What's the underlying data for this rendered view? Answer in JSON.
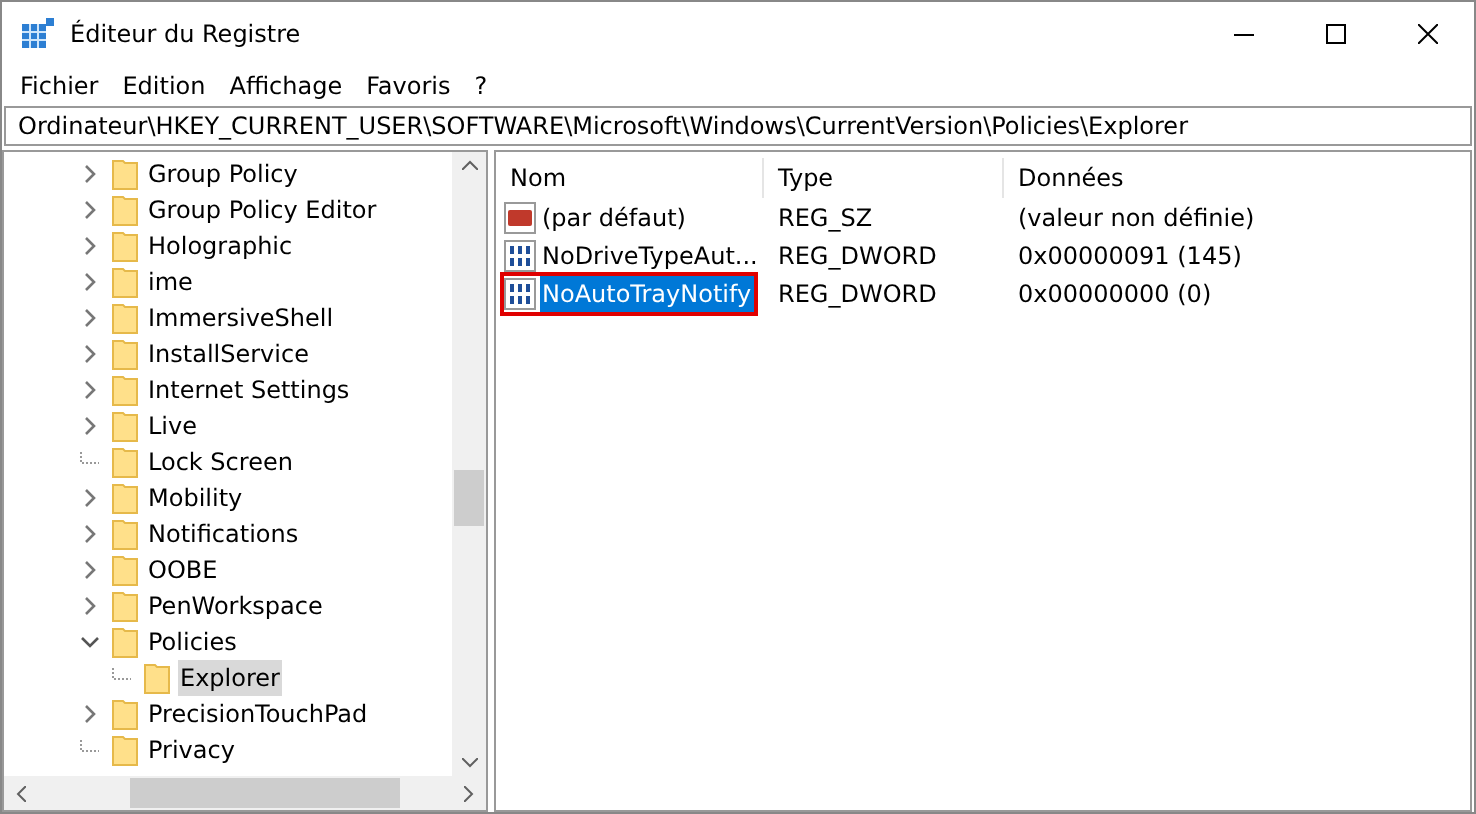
{
  "window": {
    "title": "Éditeur du Registre"
  },
  "menu": [
    "Fichier",
    "Edition",
    "Affichage",
    "Favoris",
    "?"
  ],
  "address": "Ordinateur\\HKEY_CURRENT_USER\\SOFTWARE\\Microsoft\\Windows\\CurrentVersion\\Policies\\Explorer",
  "tree": [
    {
      "label": "Group Policy",
      "kind": "collapsed"
    },
    {
      "label": "Group Policy Editor",
      "kind": "collapsed"
    },
    {
      "label": "Holographic",
      "kind": "collapsed"
    },
    {
      "label": "ime",
      "kind": "collapsed"
    },
    {
      "label": "ImmersiveShell",
      "kind": "collapsed"
    },
    {
      "label": "InstallService",
      "kind": "collapsed"
    },
    {
      "label": "Internet Settings",
      "kind": "collapsed"
    },
    {
      "label": "Live",
      "kind": "collapsed"
    },
    {
      "label": "Lock Screen",
      "kind": "leaf"
    },
    {
      "label": "Mobility",
      "kind": "collapsed"
    },
    {
      "label": "Notifications",
      "kind": "collapsed"
    },
    {
      "label": "OOBE",
      "kind": "collapsed"
    },
    {
      "label": "PenWorkspace",
      "kind": "collapsed"
    },
    {
      "label": "Policies",
      "kind": "expanded",
      "children": [
        {
          "label": "Explorer",
          "kind": "leaf",
          "selected": true
        }
      ]
    },
    {
      "label": "PrecisionTouchPad",
      "kind": "collapsed"
    },
    {
      "label": "Privacy",
      "kind": "leaf"
    }
  ],
  "table": {
    "columns": [
      "Nom",
      "Type",
      "Données"
    ],
    "rows": [
      {
        "kind": "string",
        "name": "(par défaut)",
        "type": "REG_SZ",
        "data": "(valeur non définie)",
        "selected": false,
        "highlighted": false
      },
      {
        "kind": "dword",
        "name": "NoDriveTypeAut...",
        "type": "REG_DWORD",
        "data": "0x00000091 (145)",
        "selected": false,
        "highlighted": false
      },
      {
        "kind": "dword",
        "name": "NoAutoTrayNotify",
        "type": "REG_DWORD",
        "data": "0x00000000 (0)",
        "selected": true,
        "highlighted": true
      }
    ]
  }
}
